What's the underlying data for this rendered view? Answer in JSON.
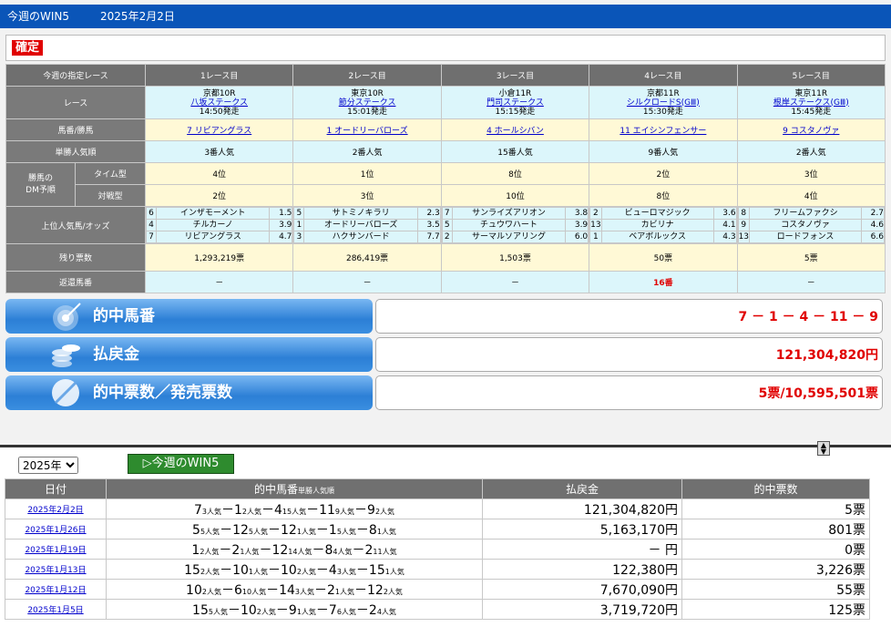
{
  "header": {
    "title": "今週のWIN5",
    "date": "2025年2月2日",
    "status": "確定"
  },
  "cols": [
    "今週の指定レース",
    "1レース目",
    "2レース目",
    "3レース目",
    "4レース目",
    "5レース目"
  ],
  "labels": {
    "race": "レース",
    "horse": "馬番/勝馬",
    "pop": "単勝人気順",
    "dm": "勝馬の DM予順",
    "dm_time": "タイム型",
    "dm_vs": "対戦型",
    "upper": "上位人気馬/オッズ",
    "remain": "残り票数",
    "refund": "返還馬番"
  },
  "races": [
    {
      "venue": "京都10R",
      "name": "八坂ステークス",
      "time": "14:50発走",
      "winner": "7 リビアングラス",
      "pop": "3番人気",
      "dm_time": "4位",
      "dm_vs": "2位",
      "odds": [
        [
          "6",
          "インザモーメント",
          "1.5"
        ],
        [
          "4",
          "チルカーノ",
          "3.9"
        ],
        [
          "7",
          "リビアングラス",
          "4.7"
        ]
      ],
      "votes": "1,293,219票",
      "refund": "－"
    },
    {
      "venue": "東京10R",
      "name": "節分ステークス",
      "time": "15:01発走",
      "winner": "1 オードリーバローズ",
      "pop": "2番人気",
      "dm_time": "1位",
      "dm_vs": "3位",
      "odds": [
        [
          "5",
          "サトミノキラリ",
          "2.3"
        ],
        [
          "1",
          "オードリーバローズ",
          "3.5"
        ],
        [
          "3",
          "ハクサンバード",
          "7.7"
        ]
      ],
      "votes": "286,419票",
      "refund": "－"
    },
    {
      "venue": "小倉11R",
      "name": "門司ステークス",
      "time": "15:15発走",
      "winner": "4 ホールシバン",
      "pop": "15番人気",
      "dm_time": "8位",
      "dm_vs": "10位",
      "odds": [
        [
          "7",
          "サンライズアリオン",
          "3.8"
        ],
        [
          "5",
          "チュウワハート",
          "3.9"
        ],
        [
          "2",
          "サーマルソアリング",
          "6.0"
        ]
      ],
      "votes": "1,503票",
      "refund": "－"
    },
    {
      "venue": "京都11R",
      "name": "シルクロードS(GⅢ)",
      "time": "15:30発走",
      "winner": "11 エイシンフェンサー",
      "pop": "9番人気",
      "dm_time": "2位",
      "dm_vs": "8位",
      "odds": [
        [
          "2",
          "ビューロマジック",
          "3.6"
        ],
        [
          "13",
          "カビリナ",
          "4.1"
        ],
        [
          "1",
          "ベアボルックス",
          "4.3"
        ]
      ],
      "votes": "50票",
      "refund": "16番"
    },
    {
      "venue": "東京11R",
      "name": "根岸ステークス(GⅢ)",
      "time": "15:45発走",
      "winner": "9 コスタノヴァ",
      "pop": "2番人気",
      "dm_time": "3位",
      "dm_vs": "4位",
      "odds": [
        [
          "8",
          "フリームファクシ",
          "2.7"
        ],
        [
          "9",
          "コスタノヴァ",
          "4.6"
        ],
        [
          "13",
          "ロードフォンス",
          "6.6"
        ]
      ],
      "votes": "5票",
      "refund": "－"
    }
  ],
  "summary": {
    "hit_label": "的中馬番",
    "hit_value": "7 － 1 － 4 － 11 － 9",
    "pay_label": "払戻金",
    "pay_value": "121,304,820円",
    "count_label": "的中票数／発売票数",
    "count_value": "5票/10,595,501票"
  },
  "history": {
    "year": "2025年",
    "button": "今週のWIN5",
    "headers": {
      "date": "日付",
      "result": "的中馬番",
      "result_sub": "単勝人気順",
      "pay": "払戻金",
      "count": "的中票数"
    },
    "rows": [
      {
        "date": "2025年2月2日",
        "legs": [
          [
            "7",
            "3人気"
          ],
          [
            "1",
            "2人気"
          ],
          [
            "4",
            "15人気"
          ],
          [
            "11",
            "9人気"
          ],
          [
            "9",
            "2人気"
          ]
        ],
        "pay": "121,304,820円",
        "count": "5票"
      },
      {
        "date": "2025年1月26日",
        "legs": [
          [
            "5",
            "5人気"
          ],
          [
            "12",
            "5人気"
          ],
          [
            "12",
            "1人気"
          ],
          [
            "1",
            "5人気"
          ],
          [
            "8",
            "1人気"
          ]
        ],
        "pay": "5,163,170円",
        "count": "801票"
      },
      {
        "date": "2025年1月19日",
        "legs": [
          [
            "1",
            "2人気"
          ],
          [
            "2",
            "1人気"
          ],
          [
            "12",
            "14人気"
          ],
          [
            "8",
            "4人気"
          ],
          [
            "2",
            "11人気"
          ]
        ],
        "pay": "－ 円",
        "count": "0票"
      },
      {
        "date": "2025年1月13日",
        "legs": [
          [
            "15",
            "2人気"
          ],
          [
            "10",
            "1人気"
          ],
          [
            "10",
            "2人気"
          ],
          [
            "4",
            "3人気"
          ],
          [
            "15",
            "1人気"
          ]
        ],
        "pay": "122,380円",
        "count": "3,226票"
      },
      {
        "date": "2025年1月12日",
        "legs": [
          [
            "10",
            "2人気"
          ],
          [
            "6",
            "10人気"
          ],
          [
            "14",
            "3人気"
          ],
          [
            "2",
            "1人気"
          ],
          [
            "12",
            "2人気"
          ]
        ],
        "pay": "7,670,090円",
        "count": "55票"
      },
      {
        "date": "2025年1月5日",
        "legs": [
          [
            "15",
            "5人気"
          ],
          [
            "10",
            "2人気"
          ],
          [
            "9",
            "1人気"
          ],
          [
            "7",
            "6人気"
          ],
          [
            "2",
            "4人気"
          ]
        ],
        "pay": "3,719,720円",
        "count": "125票"
      }
    ]
  }
}
